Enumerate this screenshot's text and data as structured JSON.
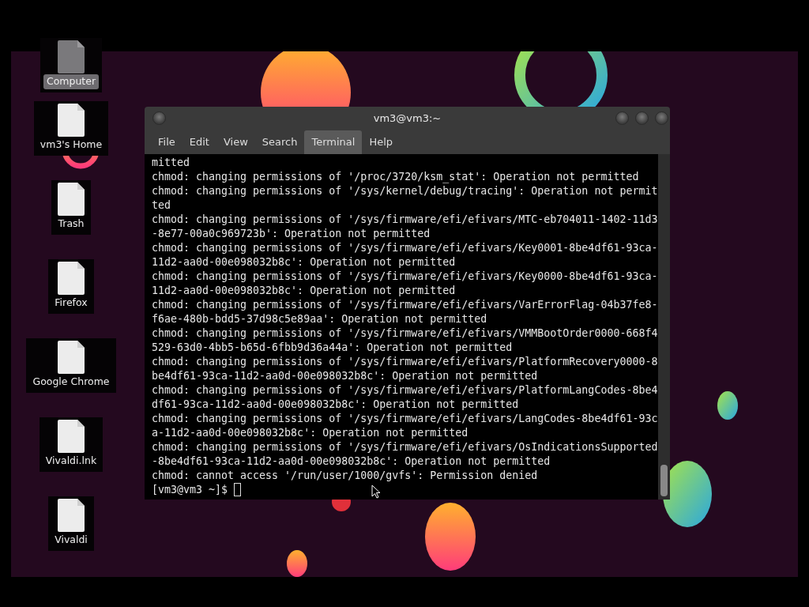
{
  "desktop_icons": [
    {
      "label": "Computer",
      "selected": true
    },
    {
      "label": "vm3's Home",
      "selected": false
    },
    {
      "label": "Trash",
      "selected": false
    },
    {
      "label": "Firefox",
      "selected": false
    },
    {
      "label": "Google Chrome",
      "selected": false
    },
    {
      "label": "Vivaldi.lnk",
      "selected": false
    },
    {
      "label": "Vivaldi",
      "selected": false
    }
  ],
  "window": {
    "title": "vm3@vm3:~"
  },
  "menu": [
    {
      "label": "File",
      "selected": false
    },
    {
      "label": "Edit",
      "selected": false
    },
    {
      "label": "View",
      "selected": false
    },
    {
      "label": "Search",
      "selected": false
    },
    {
      "label": "Terminal",
      "selected": true
    },
    {
      "label": "Help",
      "selected": false
    }
  ],
  "terminal": {
    "lines": [
      "mitted",
      "chmod: changing permissions of '/proc/3720/ksm_stat': Operation not permitted",
      "chmod: changing permissions of '/sys/kernel/debug/tracing': Operation not permitted",
      "chmod: changing permissions of '/sys/firmware/efi/efivars/MTC-eb704011-1402-11d3-8e77-00a0c969723b': Operation not permitted",
      "chmod: changing permissions of '/sys/firmware/efi/efivars/Key0001-8be4df61-93ca-11d2-aa0d-00e098032b8c': Operation not permitted",
      "chmod: changing permissions of '/sys/firmware/efi/efivars/Key0000-8be4df61-93ca-11d2-aa0d-00e098032b8c': Operation not permitted",
      "chmod: changing permissions of '/sys/firmware/efi/efivars/VarErrorFlag-04b37fe8-f6ae-480b-bdd5-37d98c5e89aa': Operation not permitted",
      "chmod: changing permissions of '/sys/firmware/efi/efivars/VMMBootOrder0000-668f4529-63d0-4bb5-b65d-6fbb9d36a44a': Operation not permitted",
      "chmod: changing permissions of '/sys/firmware/efi/efivars/PlatformRecovery0000-8be4df61-93ca-11d2-aa0d-00e098032b8c': Operation not permitted",
      "chmod: changing permissions of '/sys/firmware/efi/efivars/PlatformLangCodes-8be4df61-93ca-11d2-aa0d-00e098032b8c': Operation not permitted",
      "chmod: changing permissions of '/sys/firmware/efi/efivars/LangCodes-8be4df61-93ca-11d2-aa0d-00e098032b8c': Operation not permitted",
      "chmod: changing permissions of '/sys/firmware/efi/efivars/OsIndicationsSupported-8be4df61-93ca-11d2-aa0d-00e098032b8c': Operation not permitted",
      "chmod: cannot access '/run/user/1000/gvfs': Permission denied"
    ],
    "prompt": "[vm3@vm3 ~]$"
  }
}
